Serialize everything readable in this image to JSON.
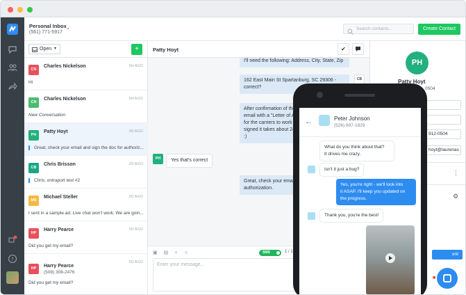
{
  "header": {
    "inbox_title": "Personal Inbox",
    "inbox_phone": "(561) 771-5917",
    "search_placeholder": "Search contacts...",
    "create_contact": "Create Contact"
  },
  "list": {
    "filter_label": "Open",
    "add_label": "+",
    "items": [
      {
        "initials": "CN",
        "name": "Charles Nickelson",
        "phone": "",
        "time": "9H AGO",
        "preview": "Hi",
        "color": "#e8505b"
      },
      {
        "initials": "CN",
        "name": "Charles Nickelson",
        "phone": "",
        "time": "9H AGO",
        "preview": "New Conversation",
        "color": "#4cbb6f"
      },
      {
        "initials": "PH",
        "name": "Patty Hoyt",
        "phone": "",
        "time": "3D AGO",
        "preview": "Great, check your email and sign the doc for authoriz...",
        "color": "#22b07d"
      },
      {
        "initials": "CB",
        "name": "Chris Brisson",
        "phone": "",
        "time": "3D AGO",
        "preview": "Chris, ontraport test #2",
        "color": "#1aa784"
      },
      {
        "initials": "MS",
        "name": "Michael Steller",
        "phone": "",
        "time": "3D AGO",
        "preview": "I sent in a sample ad. Live chat won't work. We are goin...",
        "color": "#f4b942"
      },
      {
        "initials": "HP",
        "name": "Harry Pearce",
        "phone": "",
        "time": "5D AGO",
        "preview": "Did you get my email?",
        "color": "#e8505b"
      },
      {
        "initials": "HP",
        "name": "Harry Pearce",
        "phone": "(508) 308-2476",
        "time": "5D AGO",
        "preview": "Did you get my email?",
        "color": "#e8505b"
      }
    ]
  },
  "chat": {
    "contact_name": "Patty Hoyt",
    "check_icon": "✔",
    "msg1": "I'll need the following: Address, City, State, Zip",
    "msg2a": "162 East Main St Spartanburg, SC 29306 -",
    "msg2b": "correct?",
    "msg3a": "After confirmation of the",
    "msg3b": "email with a \"Letter of A",
    "msg3c": "for the carriers to work",
    "msg3d": "signed it takes about 24",
    "msg3e": ":)",
    "reply_initials": "PH",
    "reply": "Yes that's correct",
    "msg4a": "Great, check your emai",
    "msg4b": "authorization.",
    "cb_label": "CB",
    "sms_label": "SMS",
    "count": "1 / 16",
    "composer_placeholder": "Enter your message..."
  },
  "contact": {
    "initials": "PH",
    "name": "Patty Hoyt",
    "phone_partial": "0504",
    "field_phone": "912-0504",
    "field_email": "hoyt@laurenas"
  },
  "phone": {
    "name": "Peter Johnson",
    "number": "(526) 897-1829",
    "m1a": "What do you think about that?",
    "m1b": "It drives me crazy.",
    "m2": "Isn't it just a bug?",
    "m3a": "Yes, you're right - we'll look into",
    "m3b": "it ASAP. I'll keep you updated on",
    "m3c": "the progress.",
    "m4": "Thank you, you're the best!"
  }
}
